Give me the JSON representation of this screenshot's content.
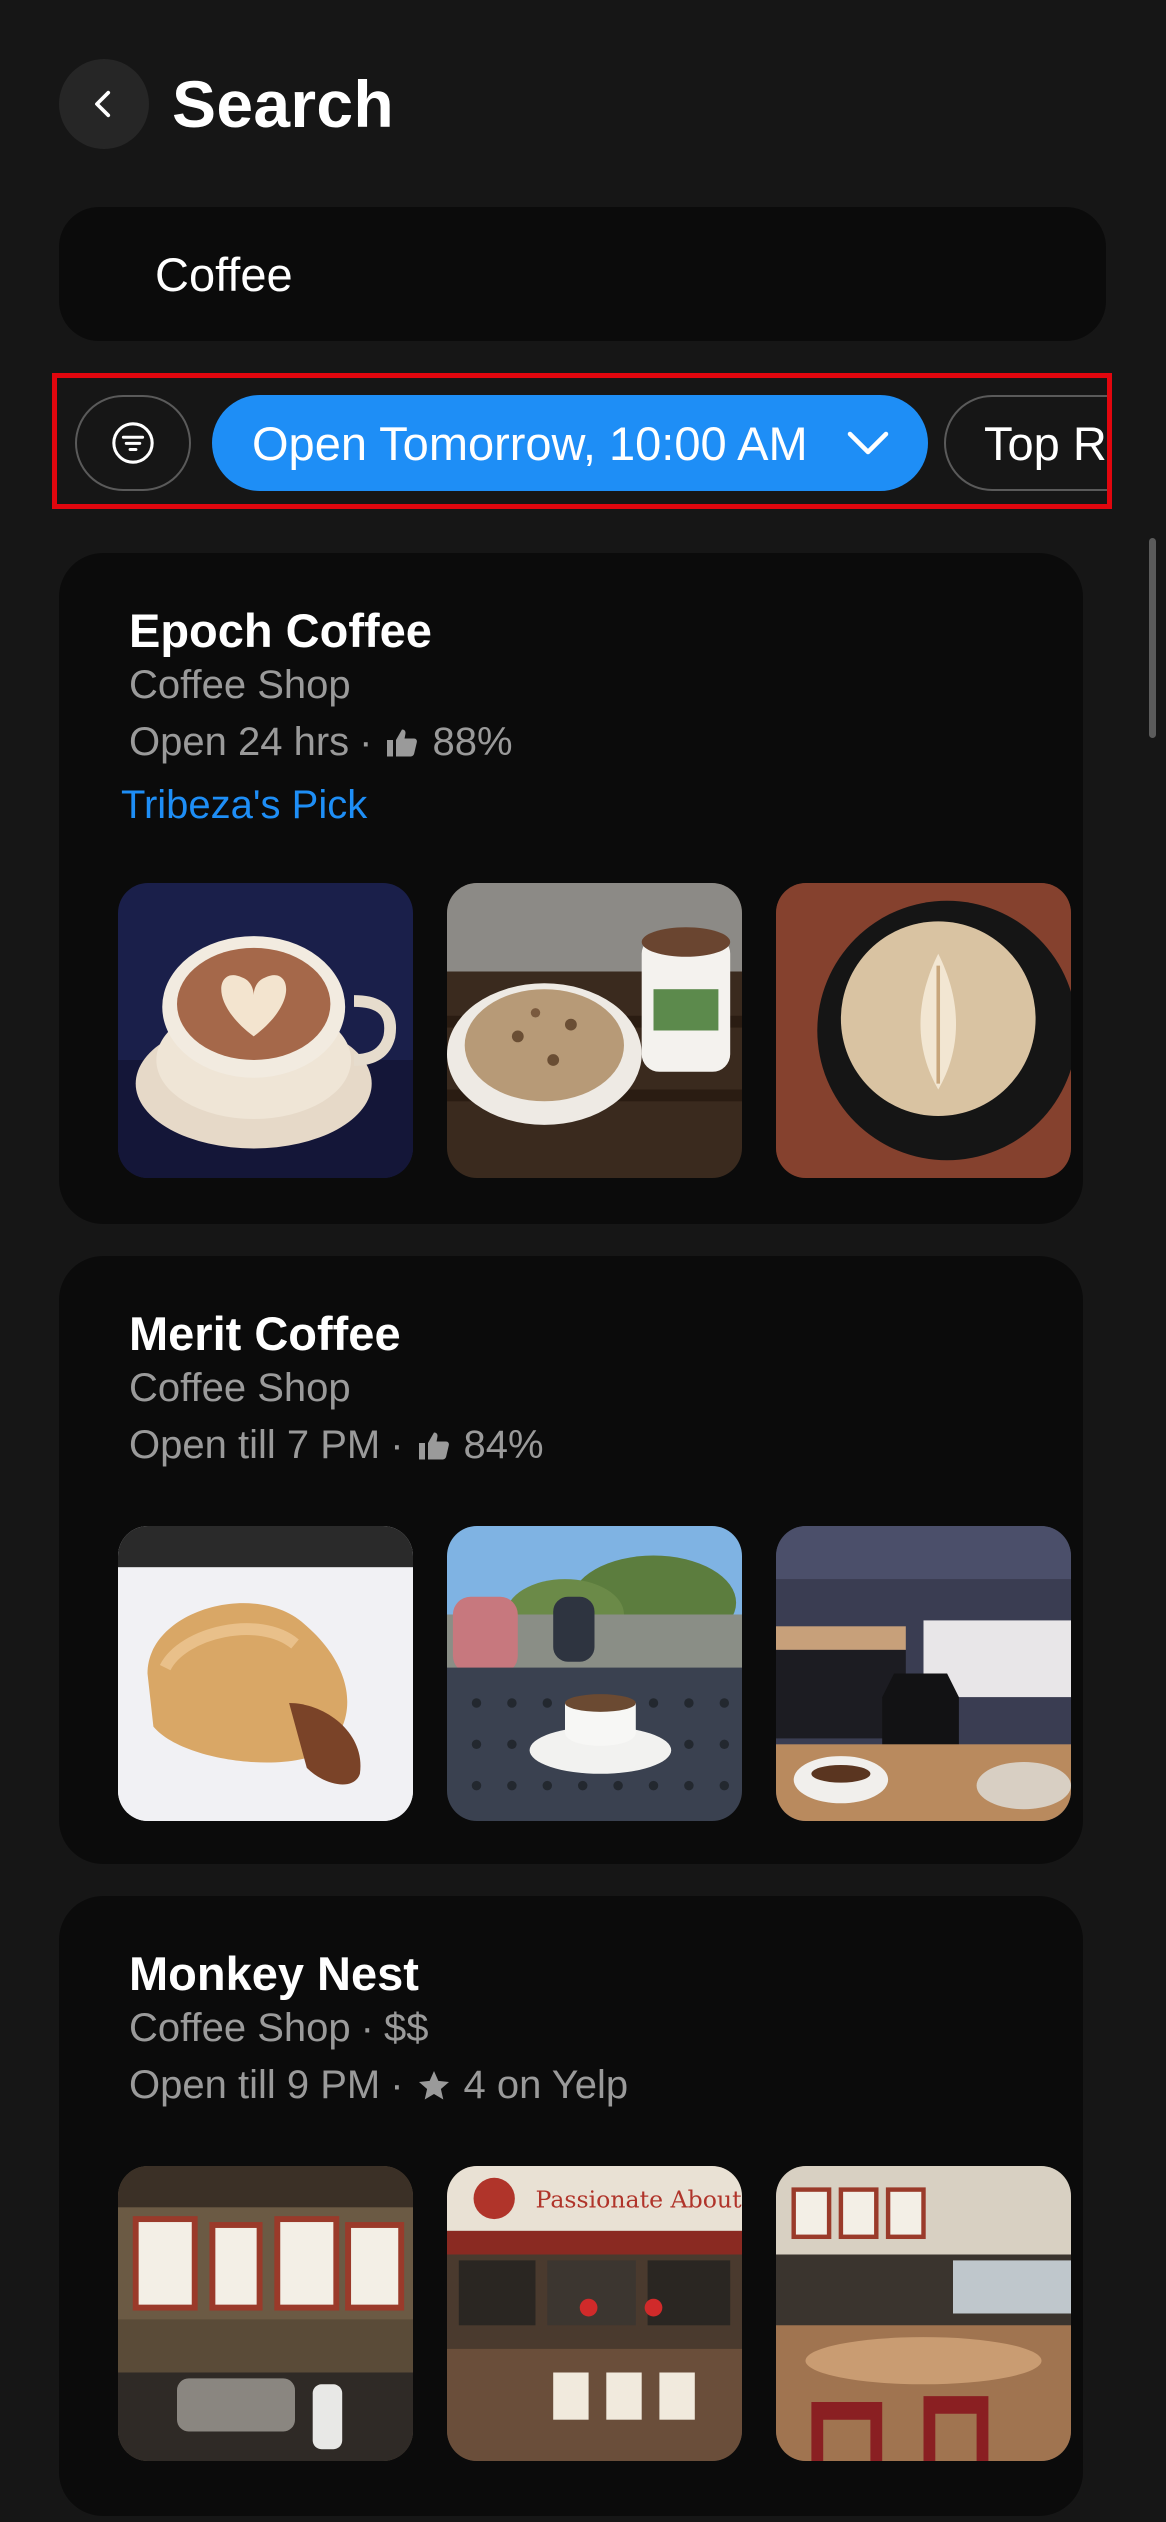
{
  "header": {
    "title": "Search",
    "back_icon": "chevron-left-icon"
  },
  "search": {
    "value": "Coffee"
  },
  "filters": {
    "filter_icon": "filter-icon",
    "chips": [
      {
        "label": "Open Tomorrow, 10:00 AM",
        "selected": true,
        "icon": "chevron-down-icon"
      },
      {
        "label": "Top R",
        "selected": false
      }
    ],
    "accent_color": "#1e8ef6",
    "highlight_color": "#e1060e"
  },
  "results": [
    {
      "name": "Epoch Coffee",
      "category": "Coffee Shop",
      "hours": "Open 24 hrs",
      "separator": "·",
      "rating": "88%",
      "rating_icon": "thumbs-up-icon",
      "pick": "Tribeza's Pick",
      "photos": [
        "latte-heart-art-photo",
        "cookie-and-mug-photo",
        "latte-leaf-art-photo"
      ]
    },
    {
      "name": "Merit Coffee",
      "category": "Coffee Shop",
      "hours": "Open till 7 PM",
      "separator": "·",
      "rating": "84%",
      "rating_icon": "thumbs-up-icon",
      "photos": [
        "kolache-pastry-photo",
        "patio-espresso-photo",
        "cafe-counter-carafe-photo"
      ]
    },
    {
      "name": "Monkey Nest",
      "category": "Coffee Shop",
      "price": "$$",
      "hours": "Open till 9 PM",
      "separator": "·",
      "rating": "4 on Yelp",
      "rating_icon": "star-icon",
      "photos": [
        "cafe-menu-wall-photo",
        "cafe-counter-photo",
        "cafe-dining-room-photo"
      ]
    }
  ]
}
